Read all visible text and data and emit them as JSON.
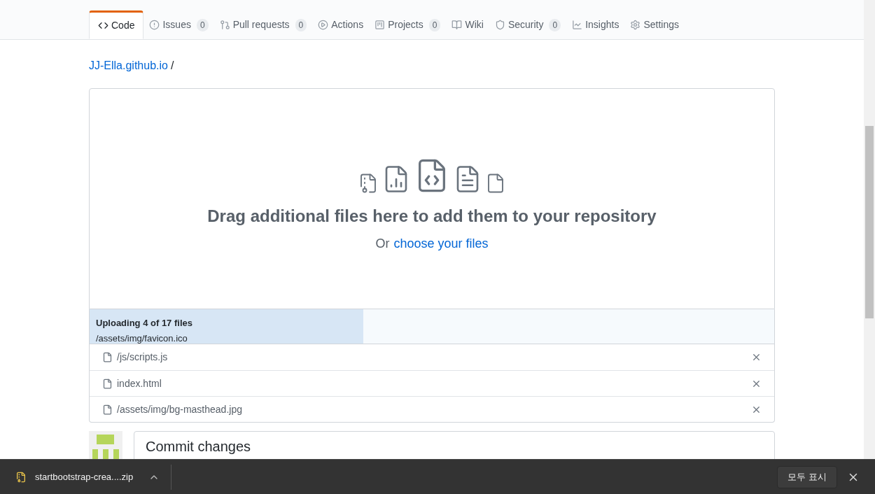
{
  "tabs": [
    {
      "label": "Code",
      "selected": true
    },
    {
      "label": "Issues",
      "count": "0",
      "selected": false
    },
    {
      "label": "Pull requests",
      "count": "0",
      "selected": false
    },
    {
      "label": "Actions",
      "selected": false
    },
    {
      "label": "Projects",
      "count": "0",
      "selected": false
    },
    {
      "label": "Wiki",
      "selected": false
    },
    {
      "label": "Security",
      "count": "0",
      "selected": false
    },
    {
      "label": "Insights",
      "selected": false
    },
    {
      "label": "Settings",
      "selected": false
    }
  ],
  "breadcrumb": {
    "repo": "JJ-Ella.github.io",
    "separator": "/"
  },
  "dropzone": {
    "heading": "Drag additional files here to add them to your repository",
    "prompt": "Or",
    "link": "choose your files"
  },
  "upload": {
    "status": "Uploading 4 of 17 files",
    "current_file": "/assets/img/favicon.ico",
    "level": 0.4
  },
  "files": [
    {
      "name": "/js/scripts.js"
    },
    {
      "name": "index.html"
    },
    {
      "name": "/assets/img/bg-masthead.jpg"
    }
  ],
  "commit": {
    "heading": "Commit changes"
  },
  "download_bar": {
    "file": "startbootstrap-crea....zip",
    "show_all": "모두 표시"
  }
}
